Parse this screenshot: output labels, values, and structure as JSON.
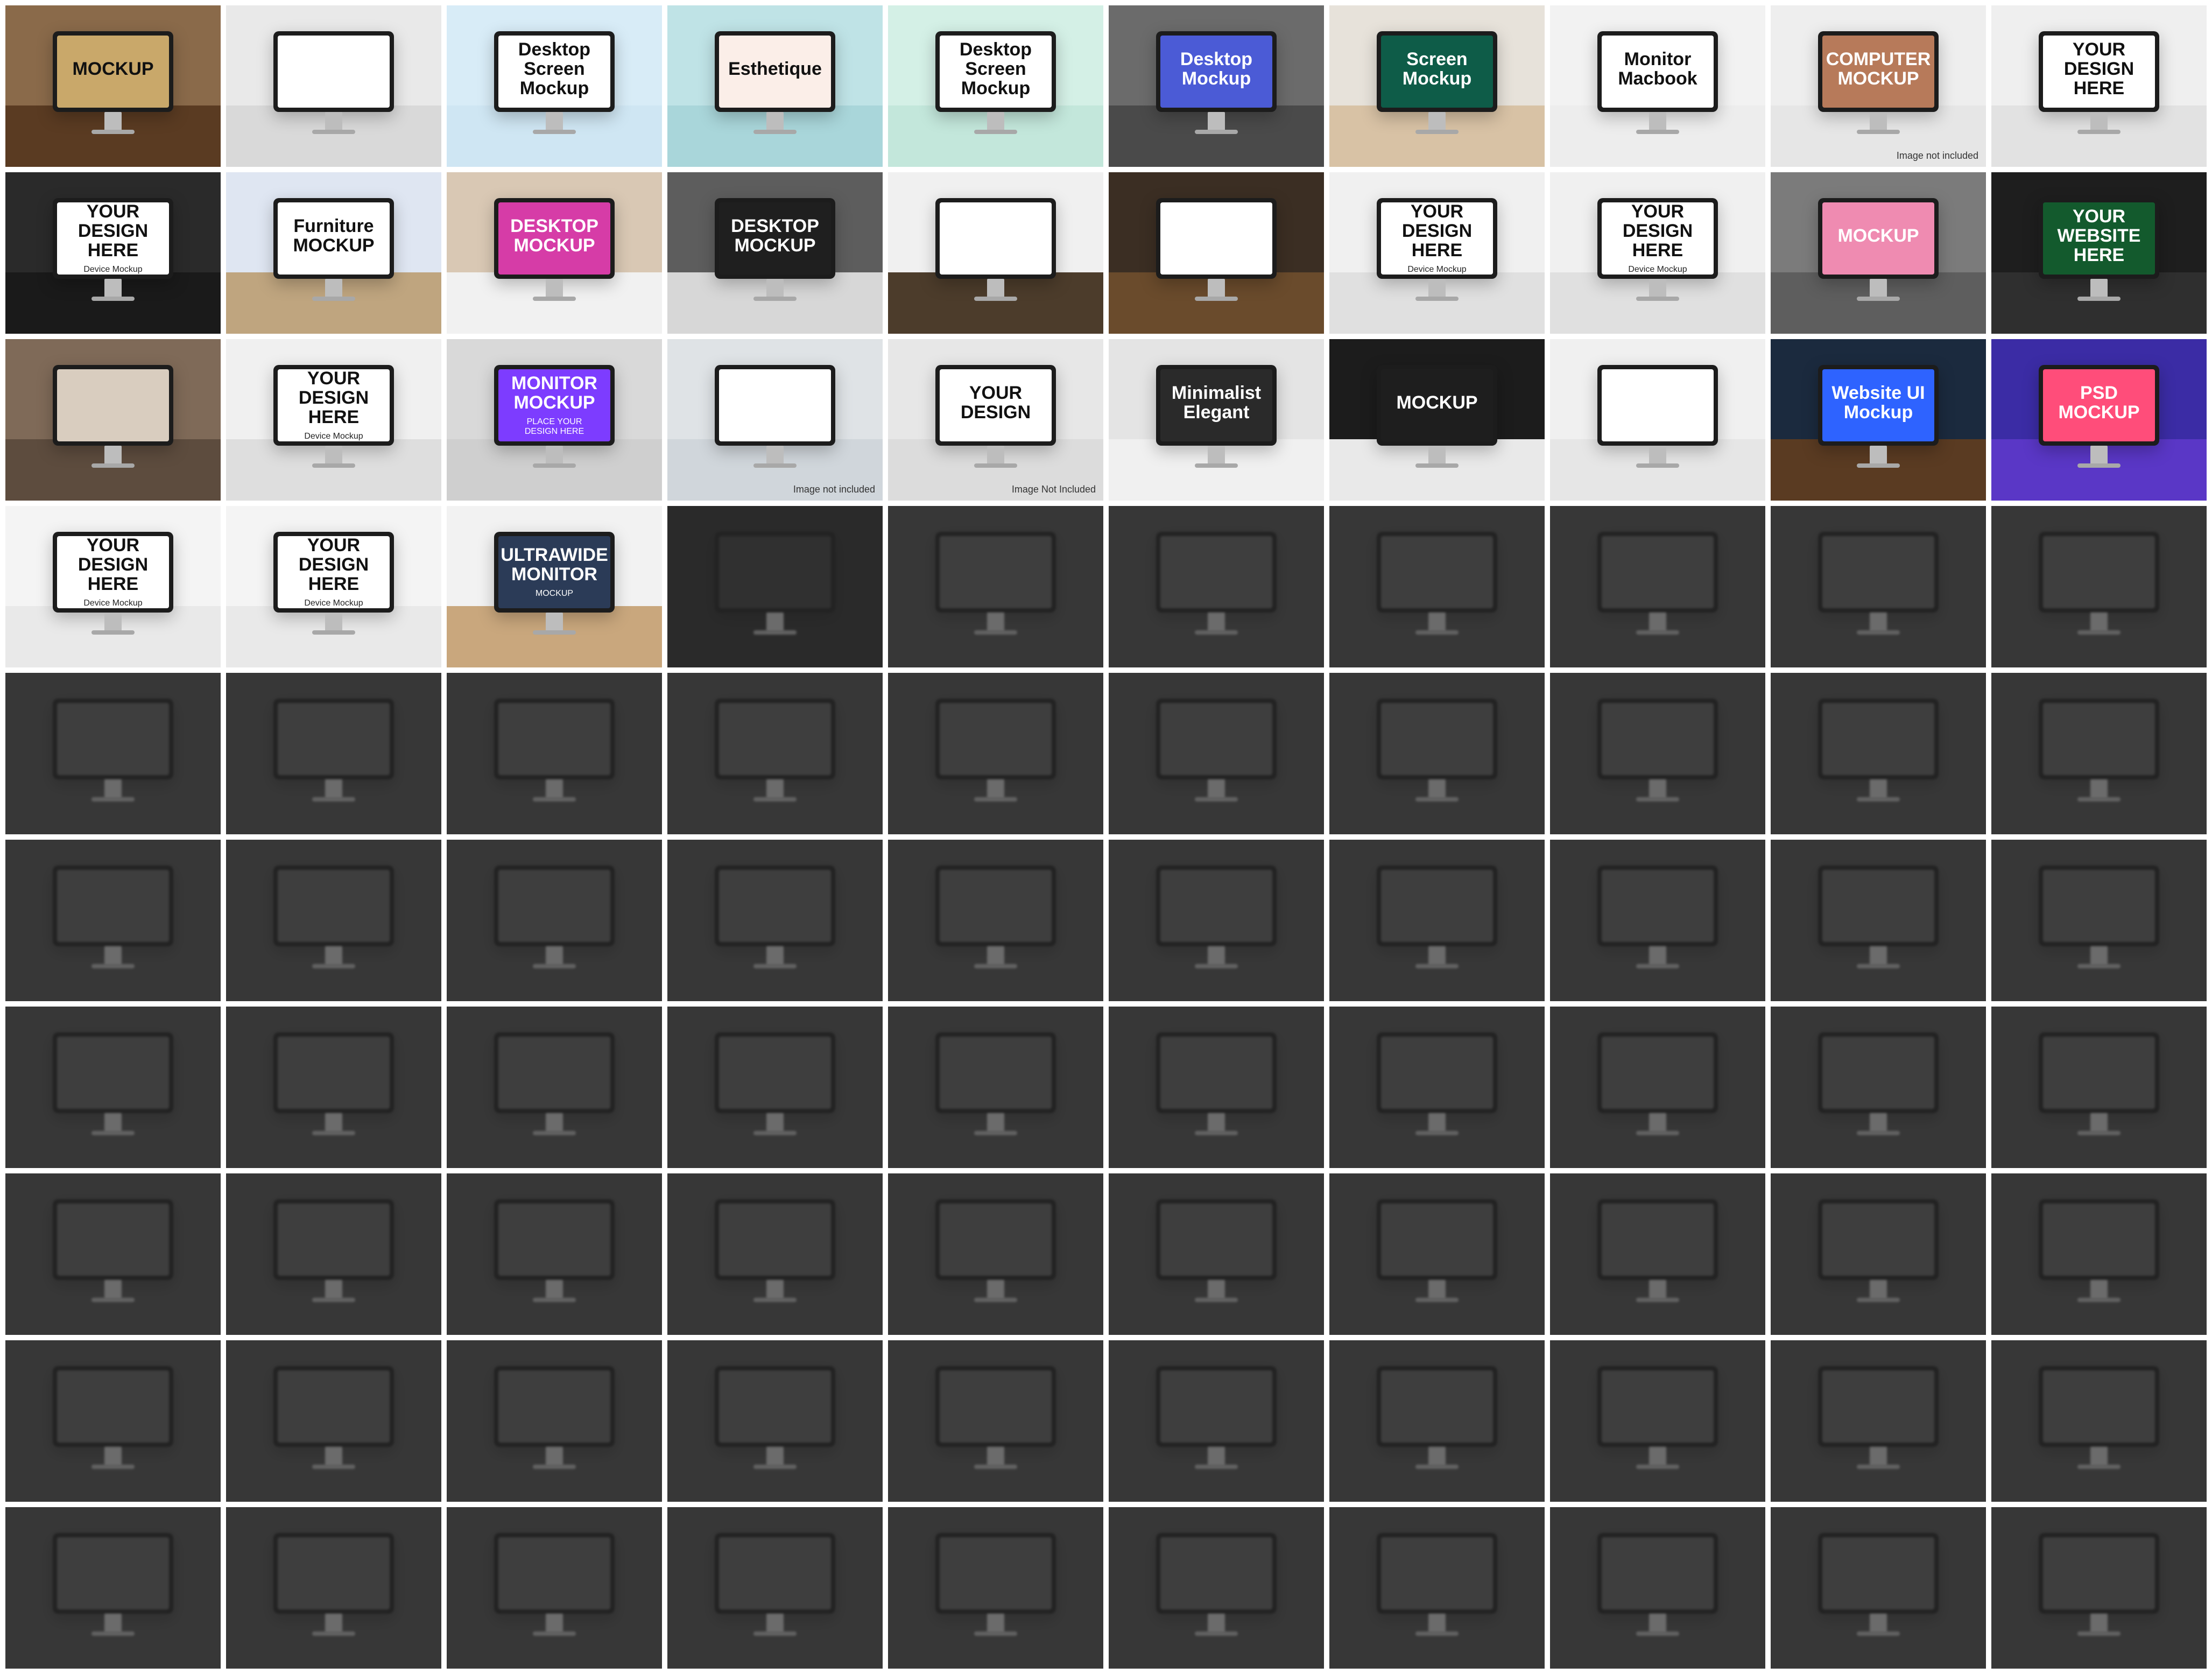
{
  "gallery": {
    "columns": 10,
    "rows": 10,
    "colors": {
      "dim_tile": "#4a4a4a",
      "background": "#ffffff"
    },
    "tiles": [
      {
        "title": "MOCKUP",
        "subtitle": "",
        "caption": "",
        "wall": "#8a6a4a",
        "desk": "#5a3b22",
        "screen": "#c9a86a",
        "dim": false
      },
      {
        "title": "",
        "subtitle": "",
        "caption": "",
        "wall": "#e9e9e9",
        "desk": "#d9d9d9",
        "screen": "#ffffff",
        "dim": false
      },
      {
        "title": "Desktop Screen Mockup",
        "subtitle": "",
        "caption": "",
        "wall": "#d8ecf7",
        "desk": "#cfe6f3",
        "screen": "#ffffff",
        "dim": false
      },
      {
        "title": "Esthetique",
        "subtitle": "",
        "caption": "",
        "wall": "#bfe3e6",
        "desk": "#a9d6da",
        "screen": "#fbeee8",
        "dim": false
      },
      {
        "title": "Desktop Screen Mockup",
        "subtitle": "",
        "caption": "",
        "wall": "#d4f0e6",
        "desk": "#c3e7db",
        "screen": "#ffffff",
        "dim": false
      },
      {
        "title": "Desktop Mockup",
        "subtitle": "",
        "caption": "",
        "wall": "#6b6b6b",
        "desk": "#4a4a4a",
        "screen": "#4b5bd6",
        "dim": false
      },
      {
        "title": "Screen Mockup",
        "subtitle": "",
        "caption": "",
        "wall": "#e7e2da",
        "desk": "#d8c2a5",
        "screen": "#0e5c48",
        "dim": false
      },
      {
        "title": "Monitor\nMacbook",
        "subtitle": "",
        "caption": "",
        "wall": "#f2f2f2",
        "desk": "#ededed",
        "screen": "#ffffff",
        "dim": false
      },
      {
        "title": "COMPUTER MOCKUP",
        "subtitle": "",
        "caption": "Image not included",
        "wall": "#eeeeee",
        "desk": "#e6e6e6",
        "screen": "#b77a5a",
        "dim": false
      },
      {
        "title": "YOUR\nDESIGN\nHERE",
        "subtitle": "",
        "caption": "",
        "wall": "#efefef",
        "desk": "#e2e2e2",
        "screen": "#ffffff",
        "dim": false
      },
      {
        "title": "YOUR\nDESIGN\nHERE",
        "subtitle": "Device Mockup",
        "caption": "",
        "wall": "#2a2a2a",
        "desk": "#1a1a1a",
        "screen": "#ffffff",
        "dim": false
      },
      {
        "title": "Furniture\nMOCKUP",
        "subtitle": "",
        "caption": "",
        "wall": "#dfe6f2",
        "desk": "#bfa57f",
        "screen": "#ffffff",
        "dim": false
      },
      {
        "title": "DESKTOP\nMOCKUP",
        "subtitle": "",
        "caption": "",
        "wall": "#d9c8b4",
        "desk": "#f1f1f1",
        "screen": "#d63ca7",
        "dim": false
      },
      {
        "title": "DESKTOP\nMOCKUP",
        "subtitle": "",
        "caption": "",
        "wall": "#5d5d5d",
        "desk": "#d7d7d7",
        "screen": "#1f1f1f",
        "dim": false
      },
      {
        "title": "",
        "subtitle": "",
        "caption": "",
        "wall": "#f0f0f0",
        "desk": "#4c3c2b",
        "screen": "#ffffff",
        "dim": false
      },
      {
        "title": "",
        "subtitle": "",
        "caption": "",
        "wall": "#3b2e23",
        "desk": "#6a4b2c",
        "screen": "#ffffff",
        "dim": false
      },
      {
        "title": "YOUR\nDESIGN\nHERE",
        "subtitle": "Device Mockup",
        "caption": "",
        "wall": "#f0f0f0",
        "desk": "#e0e0e0",
        "screen": "#ffffff",
        "dim": false
      },
      {
        "title": "YOUR\nDESIGN\nHERE",
        "subtitle": "Device Mockup",
        "caption": "",
        "wall": "#f0f0f0",
        "desk": "#e0e0e0",
        "screen": "#ffffff",
        "dim": false
      },
      {
        "title": "MOCKUP",
        "subtitle": "",
        "caption": "",
        "wall": "#7b7b7b",
        "desk": "#5e5e5e",
        "screen": "#ef8bb1",
        "dim": false
      },
      {
        "title": "YOUR WEBSITE\nHERE",
        "subtitle": "",
        "caption": "",
        "wall": "#1e1e1e",
        "desk": "#2f2f2f",
        "screen": "#135a2d",
        "dim": false
      },
      {
        "title": "",
        "subtitle": "",
        "caption": "",
        "wall": "#7f6a58",
        "desk": "#5d4c3e",
        "screen": "#d9cdbf",
        "dim": false
      },
      {
        "title": "YOUR\nDESIGN\nHERE",
        "subtitle": "Device Mockup",
        "caption": "",
        "wall": "#f0f0f0",
        "desk": "#dedede",
        "screen": "#ffffff",
        "dim": false
      },
      {
        "title": "MONITOR\nMOCKUP",
        "subtitle": "PLACE YOUR\nDESIGN HERE",
        "caption": "",
        "wall": "#d9d9d9",
        "desk": "#cfcfcf",
        "screen": "#7d3cff",
        "dim": false
      },
      {
        "title": "",
        "subtitle": "",
        "caption": "Image not included",
        "wall": "#dfe3e6",
        "desk": "#d0d6db",
        "screen": "#ffffff",
        "dim": false
      },
      {
        "title": "YOUR\nDESIGN",
        "subtitle": "",
        "caption": "Image Not Included",
        "wall": "#e7e7e7",
        "desk": "#dcdcdc",
        "screen": "#ffffff",
        "dim": false
      },
      {
        "title": "Minimalist\nElegant",
        "subtitle": "",
        "caption": "",
        "wall": "#e4e4e4",
        "desk": "#f0f0f0",
        "screen": "#2a2a2a",
        "dim": false
      },
      {
        "title": "MOCKUP",
        "subtitle": "",
        "caption": "",
        "wall": "#1c1c1c",
        "desk": "#e9e9e9",
        "screen": "#1e1e1e",
        "dim": false
      },
      {
        "title": "",
        "subtitle": "",
        "caption": "",
        "wall": "#f0f0f0",
        "desk": "#e6e6e6",
        "screen": "#ffffff",
        "dim": false
      },
      {
        "title": "Website UI\nMockup",
        "subtitle": "",
        "caption": "",
        "wall": "#1b2a3e",
        "desk": "#5a3b22",
        "screen": "#2e63ff",
        "dim": false
      },
      {
        "title": "PSD\nMOCKUP",
        "subtitle": "",
        "caption": "",
        "wall": "#3b2ca5",
        "desk": "#5a37c6",
        "screen": "#ff4d7a",
        "dim": false
      },
      {
        "title": "YOUR\nDESIGN\nHERE",
        "subtitle": "Device Mockup",
        "caption": "",
        "wall": "#f4f4f4",
        "desk": "#e9e9e9",
        "screen": "#ffffff",
        "dim": false
      },
      {
        "title": "YOUR\nDESIGN\nHERE",
        "subtitle": "Device Mockup",
        "caption": "",
        "wall": "#f4f4f4",
        "desk": "#e9e9e9",
        "screen": "#ffffff",
        "dim": false
      },
      {
        "title": "ULTRAWIDE\nMONITOR",
        "subtitle": "MOCKUP",
        "caption": "",
        "wall": "#f2f2f2",
        "desk": "#c9a77d",
        "screen": "#2b3b57",
        "dim": false
      },
      {
        "title": "",
        "subtitle": "",
        "caption": "",
        "wall": "#2e2e2e",
        "desk": "#2e2e2e",
        "screen": "#3a3a3a",
        "dim": true
      },
      {
        "title": "",
        "subtitle": "",
        "caption": "",
        "wall": "#4a4a4a",
        "desk": "#4a4a4a",
        "screen": "#5a5a5a",
        "dim": true
      },
      {
        "title": "",
        "subtitle": "",
        "caption": "",
        "wall": "#4a4a4a",
        "desk": "#4a4a4a",
        "screen": "#5a5a5a",
        "dim": true
      },
      {
        "title": "",
        "subtitle": "",
        "caption": "",
        "wall": "#4a4a4a",
        "desk": "#4a4a4a",
        "screen": "#5a5a5a",
        "dim": true
      },
      {
        "title": "",
        "subtitle": "",
        "caption": "",
        "wall": "#4a4a4a",
        "desk": "#4a4a4a",
        "screen": "#5a5a5a",
        "dim": true
      },
      {
        "title": "",
        "subtitle": "",
        "caption": "",
        "wall": "#4a4a4a",
        "desk": "#4a4a4a",
        "screen": "#5a5a5a",
        "dim": true
      },
      {
        "title": "",
        "subtitle": "",
        "caption": "",
        "wall": "#4a4a4a",
        "desk": "#4a4a4a",
        "screen": "#5a5a5a",
        "dim": true
      },
      {
        "title": "",
        "subtitle": "",
        "caption": "",
        "wall": "#4a4a4a",
        "desk": "#4a4a4a",
        "screen": "#5a5a5a",
        "dim": true
      },
      {
        "title": "",
        "subtitle": "",
        "caption": "",
        "wall": "#4a4a4a",
        "desk": "#4a4a4a",
        "screen": "#5a5a5a",
        "dim": true
      },
      {
        "title": "",
        "subtitle": "",
        "caption": "",
        "wall": "#4a4a4a",
        "desk": "#4a4a4a",
        "screen": "#5a5a5a",
        "dim": true
      },
      {
        "title": "",
        "subtitle": "",
        "caption": "",
        "wall": "#4a4a4a",
        "desk": "#4a4a4a",
        "screen": "#5a5a5a",
        "dim": true
      },
      {
        "title": "",
        "subtitle": "",
        "caption": "",
        "wall": "#4a4a4a",
        "desk": "#4a4a4a",
        "screen": "#5a5a5a",
        "dim": true
      },
      {
        "title": "",
        "subtitle": "",
        "caption": "",
        "wall": "#4a4a4a",
        "desk": "#4a4a4a",
        "screen": "#5a5a5a",
        "dim": true
      },
      {
        "title": "",
        "subtitle": "",
        "caption": "",
        "wall": "#4a4a4a",
        "desk": "#4a4a4a",
        "screen": "#5a5a5a",
        "dim": true
      },
      {
        "title": "",
        "subtitle": "",
        "caption": "",
        "wall": "#4a4a4a",
        "desk": "#4a4a4a",
        "screen": "#5a5a5a",
        "dim": true
      },
      {
        "title": "",
        "subtitle": "",
        "caption": "",
        "wall": "#4a4a4a",
        "desk": "#4a4a4a",
        "screen": "#5a5a5a",
        "dim": true
      },
      {
        "title": "",
        "subtitle": "",
        "caption": "",
        "wall": "#4a4a4a",
        "desk": "#4a4a4a",
        "screen": "#5a5a5a",
        "dim": true
      },
      {
        "title": "",
        "subtitle": "",
        "caption": "",
        "wall": "#4a4a4a",
        "desk": "#4a4a4a",
        "screen": "#5a5a5a",
        "dim": true
      },
      {
        "title": "",
        "subtitle": "",
        "caption": "",
        "wall": "#4a4a4a",
        "desk": "#4a4a4a",
        "screen": "#5a5a5a",
        "dim": true
      },
      {
        "title": "",
        "subtitle": "",
        "caption": "",
        "wall": "#4a4a4a",
        "desk": "#4a4a4a",
        "screen": "#5a5a5a",
        "dim": true
      },
      {
        "title": "",
        "subtitle": "",
        "caption": "",
        "wall": "#4a4a4a",
        "desk": "#4a4a4a",
        "screen": "#5a5a5a",
        "dim": true
      },
      {
        "title": "",
        "subtitle": "",
        "caption": "",
        "wall": "#4a4a4a",
        "desk": "#4a4a4a",
        "screen": "#5a5a5a",
        "dim": true
      },
      {
        "title": "",
        "subtitle": "",
        "caption": "",
        "wall": "#4a4a4a",
        "desk": "#4a4a4a",
        "screen": "#5a5a5a",
        "dim": true
      },
      {
        "title": "",
        "subtitle": "",
        "caption": "",
        "wall": "#4a4a4a",
        "desk": "#4a4a4a",
        "screen": "#5a5a5a",
        "dim": true
      },
      {
        "title": "",
        "subtitle": "",
        "caption": "",
        "wall": "#4a4a4a",
        "desk": "#4a4a4a",
        "screen": "#5a5a5a",
        "dim": true
      },
      {
        "title": "",
        "subtitle": "",
        "caption": "",
        "wall": "#4a4a4a",
        "desk": "#4a4a4a",
        "screen": "#5a5a5a",
        "dim": true
      },
      {
        "title": "",
        "subtitle": "",
        "caption": "",
        "wall": "#4a4a4a",
        "desk": "#4a4a4a",
        "screen": "#5a5a5a",
        "dim": true
      },
      {
        "title": "",
        "subtitle": "",
        "caption": "",
        "wall": "#4a4a4a",
        "desk": "#4a4a4a",
        "screen": "#5a5a5a",
        "dim": true
      },
      {
        "title": "",
        "subtitle": "",
        "caption": "",
        "wall": "#4a4a4a",
        "desk": "#4a4a4a",
        "screen": "#5a5a5a",
        "dim": true
      },
      {
        "title": "",
        "subtitle": "",
        "caption": "",
        "wall": "#4a4a4a",
        "desk": "#4a4a4a",
        "screen": "#5a5a5a",
        "dim": true
      },
      {
        "title": "",
        "subtitle": "",
        "caption": "",
        "wall": "#4a4a4a",
        "desk": "#4a4a4a",
        "screen": "#5a5a5a",
        "dim": true
      },
      {
        "title": "",
        "subtitle": "",
        "caption": "",
        "wall": "#4a4a4a",
        "desk": "#4a4a4a",
        "screen": "#5a5a5a",
        "dim": true
      },
      {
        "title": "",
        "subtitle": "",
        "caption": "",
        "wall": "#4a4a4a",
        "desk": "#4a4a4a",
        "screen": "#5a5a5a",
        "dim": true
      },
      {
        "title": "",
        "subtitle": "",
        "caption": "",
        "wall": "#4a4a4a",
        "desk": "#4a4a4a",
        "screen": "#5a5a5a",
        "dim": true
      },
      {
        "title": "",
        "subtitle": "",
        "caption": "",
        "wall": "#4a4a4a",
        "desk": "#4a4a4a",
        "screen": "#5a5a5a",
        "dim": true
      },
      {
        "title": "",
        "subtitle": "",
        "caption": "",
        "wall": "#4a4a4a",
        "desk": "#4a4a4a",
        "screen": "#5a5a5a",
        "dim": true
      },
      {
        "title": "",
        "subtitle": "",
        "caption": "",
        "wall": "#4a4a4a",
        "desk": "#4a4a4a",
        "screen": "#5a5a5a",
        "dim": true
      },
      {
        "title": "",
        "subtitle": "",
        "caption": "",
        "wall": "#4a4a4a",
        "desk": "#4a4a4a",
        "screen": "#5a5a5a",
        "dim": true
      },
      {
        "title": "",
        "subtitle": "",
        "caption": "",
        "wall": "#4a4a4a",
        "desk": "#4a4a4a",
        "screen": "#5a5a5a",
        "dim": true
      },
      {
        "title": "",
        "subtitle": "",
        "caption": "",
        "wall": "#4a4a4a",
        "desk": "#4a4a4a",
        "screen": "#5a5a5a",
        "dim": true
      },
      {
        "title": "",
        "subtitle": "",
        "caption": "",
        "wall": "#4a4a4a",
        "desk": "#4a4a4a",
        "screen": "#5a5a5a",
        "dim": true
      },
      {
        "title": "",
        "subtitle": "",
        "caption": "",
        "wall": "#4a4a4a",
        "desk": "#4a4a4a",
        "screen": "#5a5a5a",
        "dim": true
      },
      {
        "title": "",
        "subtitle": "",
        "caption": "",
        "wall": "#4a4a4a",
        "desk": "#4a4a4a",
        "screen": "#5a5a5a",
        "dim": true
      },
      {
        "title": "",
        "subtitle": "",
        "caption": "",
        "wall": "#4a4a4a",
        "desk": "#4a4a4a",
        "screen": "#5a5a5a",
        "dim": true
      },
      {
        "title": "",
        "subtitle": "",
        "caption": "",
        "wall": "#4a4a4a",
        "desk": "#4a4a4a",
        "screen": "#5a5a5a",
        "dim": true
      },
      {
        "title": "",
        "subtitle": "",
        "caption": "",
        "wall": "#4a4a4a",
        "desk": "#4a4a4a",
        "screen": "#5a5a5a",
        "dim": true
      },
      {
        "title": "",
        "subtitle": "",
        "caption": "",
        "wall": "#4a4a4a",
        "desk": "#4a4a4a",
        "screen": "#5a5a5a",
        "dim": true
      },
      {
        "title": "",
        "subtitle": "",
        "caption": "",
        "wall": "#4a4a4a",
        "desk": "#4a4a4a",
        "screen": "#5a5a5a",
        "dim": true
      },
      {
        "title": "",
        "subtitle": "",
        "caption": "",
        "wall": "#4a4a4a",
        "desk": "#4a4a4a",
        "screen": "#5a5a5a",
        "dim": true
      },
      {
        "title": "",
        "subtitle": "",
        "caption": "",
        "wall": "#4a4a4a",
        "desk": "#4a4a4a",
        "screen": "#5a5a5a",
        "dim": true
      },
      {
        "title": "",
        "subtitle": "",
        "caption": "",
        "wall": "#4a4a4a",
        "desk": "#4a4a4a",
        "screen": "#5a5a5a",
        "dim": true
      },
      {
        "title": "",
        "subtitle": "",
        "caption": "",
        "wall": "#4a4a4a",
        "desk": "#4a4a4a",
        "screen": "#5a5a5a",
        "dim": true
      },
      {
        "title": "",
        "subtitle": "",
        "caption": "",
        "wall": "#4a4a4a",
        "desk": "#4a4a4a",
        "screen": "#5a5a5a",
        "dim": true
      },
      {
        "title": "",
        "subtitle": "",
        "caption": "",
        "wall": "#4a4a4a",
        "desk": "#4a4a4a",
        "screen": "#5a5a5a",
        "dim": true
      },
      {
        "title": "",
        "subtitle": "",
        "caption": "",
        "wall": "#4a4a4a",
        "desk": "#4a4a4a",
        "screen": "#5a5a5a",
        "dim": true
      },
      {
        "title": "",
        "subtitle": "",
        "caption": "",
        "wall": "#4a4a4a",
        "desk": "#4a4a4a",
        "screen": "#5a5a5a",
        "dim": true
      },
      {
        "title": "",
        "subtitle": "",
        "caption": "",
        "wall": "#4a4a4a",
        "desk": "#4a4a4a",
        "screen": "#5a5a5a",
        "dim": true
      },
      {
        "title": "",
        "subtitle": "",
        "caption": "",
        "wall": "#4a4a4a",
        "desk": "#4a4a4a",
        "screen": "#5a5a5a",
        "dim": true
      },
      {
        "title": "",
        "subtitle": "",
        "caption": "",
        "wall": "#4a4a4a",
        "desk": "#4a4a4a",
        "screen": "#5a5a5a",
        "dim": true
      },
      {
        "title": "",
        "subtitle": "",
        "caption": "",
        "wall": "#4a4a4a",
        "desk": "#4a4a4a",
        "screen": "#5a5a5a",
        "dim": true
      },
      {
        "title": "",
        "subtitle": "",
        "caption": "",
        "wall": "#4a4a4a",
        "desk": "#4a4a4a",
        "screen": "#5a5a5a",
        "dim": true
      },
      {
        "title": "",
        "subtitle": "",
        "caption": "",
        "wall": "#4a4a4a",
        "desk": "#4a4a4a",
        "screen": "#5a5a5a",
        "dim": true
      },
      {
        "title": "",
        "subtitle": "",
        "caption": "",
        "wall": "#4a4a4a",
        "desk": "#4a4a4a",
        "screen": "#5a5a5a",
        "dim": true
      },
      {
        "title": "",
        "subtitle": "",
        "caption": "",
        "wall": "#4a4a4a",
        "desk": "#4a4a4a",
        "screen": "#5a5a5a",
        "dim": true
      },
      {
        "title": "",
        "subtitle": "",
        "caption": "",
        "wall": "#4a4a4a",
        "desk": "#4a4a4a",
        "screen": "#5a5a5a",
        "dim": true
      },
      {
        "title": "",
        "subtitle": "",
        "caption": "",
        "wall": "#4a4a4a",
        "desk": "#4a4a4a",
        "screen": "#5a5a5a",
        "dim": true
      },
      {
        "title": "",
        "subtitle": "",
        "caption": "",
        "wall": "#4a4a4a",
        "desk": "#4a4a4a",
        "screen": "#5a5a5a",
        "dim": true
      }
    ]
  }
}
